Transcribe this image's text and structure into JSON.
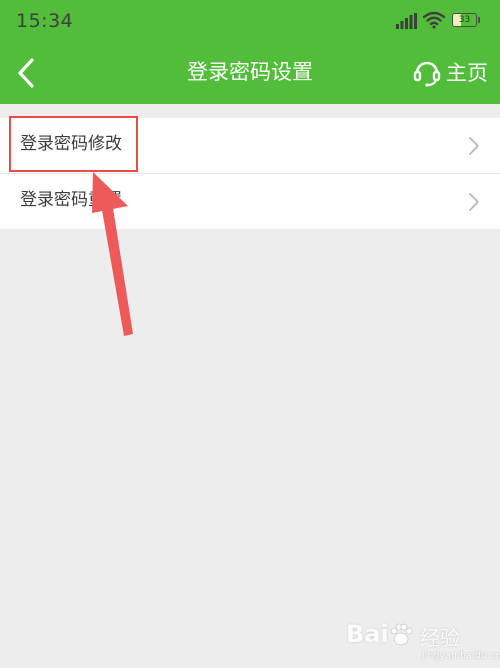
{
  "status_bar": {
    "time": "15:34",
    "battery": "33",
    "battery_level": 0.33,
    "icons": [
      "signal-icon",
      "wifi-icon",
      "battery-icon"
    ]
  },
  "nav": {
    "title": "登录密码设置",
    "home_label": "主页",
    "back_icon": "chevron-left-icon",
    "home_icon": "headset-icon"
  },
  "menu": {
    "items": [
      {
        "label": "登录密码修改"
      },
      {
        "label": "登录密码重置"
      }
    ]
  },
  "watermark": {
    "brand": "Bai",
    "sub": "经验",
    "url": "jingyan.baidu.com"
  },
  "colors": {
    "header": "#52bd3a",
    "background": "#ecedec",
    "annotation": "#e74c4c"
  }
}
